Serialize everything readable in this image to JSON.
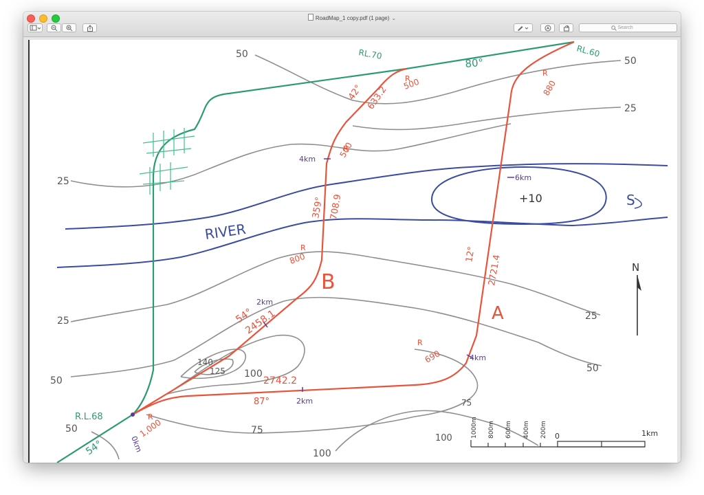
{
  "window": {
    "title": "RoadMap_1 copy.pdf (1 page)",
    "search_placeholder": "Search"
  },
  "colors": {
    "road_a_b": "#e8533b",
    "alt_route": "#2c9a74",
    "river": "#3a4ba0",
    "contour": "#8e8e8e",
    "km_marks": "#5b3a9c",
    "ink": "#333333"
  },
  "toolbar": {
    "sidebar_icon": "sidebar-icon",
    "zoom_out_icon": "zoom-out-icon",
    "zoom_in_icon": "zoom-in-icon",
    "share_icon": "share-icon",
    "markup_icon": "pen-icon",
    "annotate_icon": "annotate-icon",
    "rotate_icon": "rotate-icon"
  },
  "map": {
    "contours": {
      "c50_top": "50",
      "c50_right_top": "50",
      "c25_right_top": "25",
      "c25_left": "25",
      "c25_left_low": "25",
      "c25_right_low": "25",
      "c50_left_low": "50",
      "c50_right_low": "50",
      "c50_bottom_left": "50",
      "c140": "140",
      "c125": "125",
      "c100_hill": "100",
      "c75_bottom": "75",
      "c75_right": "75",
      "c100_bottom": "100",
      "c100_bottom_right": "100"
    },
    "river_label": "RIVER",
    "island_label": "+10",
    "flow_symbol": "S",
    "north_label": "N",
    "reduced_levels": {
      "rl70": "RL.70",
      "rl60": "RL.60",
      "rl68": "R.L.68"
    },
    "angles": {
      "a80": "80°",
      "a42": "42°",
      "a12": "12°",
      "a54": "54°",
      "a87": "87°",
      "a54_bottom": "54°",
      "a359": "359°"
    },
    "radii": {
      "r500_top": "R",
      "r500_top_val": "500",
      "r880": "R",
      "r880_val": "880",
      "r500_mid": "R",
      "r500_mid_val": "500",
      "r800": "R",
      "r800_val": "800",
      "r690": "R",
      "r690_val": "690",
      "r1000": "R",
      "r1000_val": "1,000"
    },
    "lengths": {
      "l633": "633.2",
      "l708": "708.9",
      "l2721": "2721.4",
      "l2458": "2458.1",
      "l2742": "2742.2"
    },
    "km_marks": {
      "km4_b": "4km",
      "km2_b": "2km",
      "km6_a": "6km",
      "km4_a": "4km",
      "km2_a": "2km",
      "km0": "0km"
    },
    "routes": {
      "route_a": "A",
      "route_b": "B"
    },
    "scale_bar": {
      "ticks": [
        "1000m",
        "800m",
        "600m",
        "400m",
        "200m"
      ],
      "zero": "0",
      "end": "1km"
    }
  }
}
